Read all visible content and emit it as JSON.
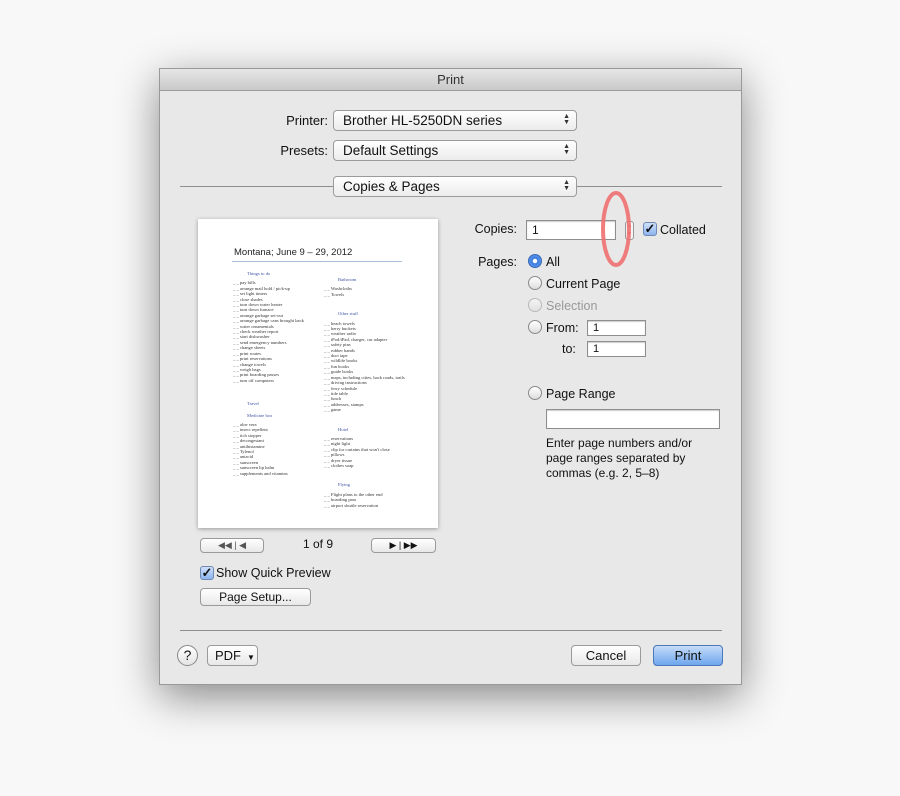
{
  "window": {
    "title": "Print"
  },
  "printer": {
    "label": "Printer:",
    "value": "Brother HL-5250DN series"
  },
  "presets": {
    "label": "Presets:",
    "value": "Default Settings"
  },
  "section": {
    "value": "Copies & Pages"
  },
  "copies": {
    "label": "Copies:",
    "value": "1",
    "collated_label": "Collated",
    "collated": true
  },
  "pages": {
    "label": "Pages:",
    "all": "All",
    "current": "Current Page",
    "selection": "Selection",
    "from_label": "From:",
    "from_value": "1",
    "to_label": "to:",
    "to_value": "1",
    "range_label": "Page Range",
    "range_value": "",
    "hint": "Enter page numbers and/or page ranges separated by commas (e.g. 2, 5–8)",
    "selected": "All"
  },
  "preview": {
    "title": "Montana; June 9 – 29, 2012",
    "left": [
      {
        "h": "Things to do",
        "items": [
          "pay bills",
          "arrange mail hold / pick-up",
          "set light timers",
          "close shades",
          "turn down water heater",
          "turn down furnace",
          "arrange garbage set-out",
          "arrange garbage cans brought back",
          "water ornamentals",
          "check weather report",
          "start dishwasher",
          "send emergency numbers",
          "change sheets",
          "print routes",
          "print reservations",
          "change towels",
          "weigh bags",
          "print boarding passes",
          "turn off computers"
        ]
      },
      {
        "h": "Travel",
        "items": []
      },
      {
        "h": "Medicine box",
        "items": [
          "aloe vera",
          "insect repellent",
          "itch stopper",
          "decongestant",
          "antihistamine",
          "Tylenol",
          "antacid",
          "sunscreen",
          "sunscreen lip balm",
          "supplements and vitamins"
        ]
      }
    ],
    "right": [
      {
        "h": "Bathroom",
        "items": [
          "Washcloths",
          "Towels"
        ]
      },
      {
        "h": "Other stuff",
        "items": [
          "beach towels",
          "berry buckets",
          "weather radio",
          "iPod/iPad, charger, car adapter",
          "safety pins",
          "rubber bands",
          "duct tape",
          "wildlife books",
          "fun books",
          "guide books",
          "maps, including cities, back roads, trails",
          "driving instructions",
          "ferry schedule",
          "tide table",
          "lunch",
          "addresses, stamps",
          "game"
        ]
      },
      {
        "h": "Hotel",
        "items": [
          "reservations",
          "night light",
          "clip for curtains that won't close",
          "pillows",
          "dryer tissue",
          "clothes soap"
        ]
      },
      {
        "h": "Flying",
        "items": [
          "Flight plans to the other end",
          "boarding pass",
          "airport shuttle reservation"
        ]
      }
    ],
    "page_indicator": "1 of 9"
  },
  "quick_preview": {
    "label": "Show Quick Preview",
    "checked": true
  },
  "page_setup": {
    "label": "Page Setup..."
  },
  "footer": {
    "help": "?",
    "pdf": "PDF",
    "cancel": "Cancel",
    "print": "Print"
  },
  "annotation_color": "#f07070"
}
